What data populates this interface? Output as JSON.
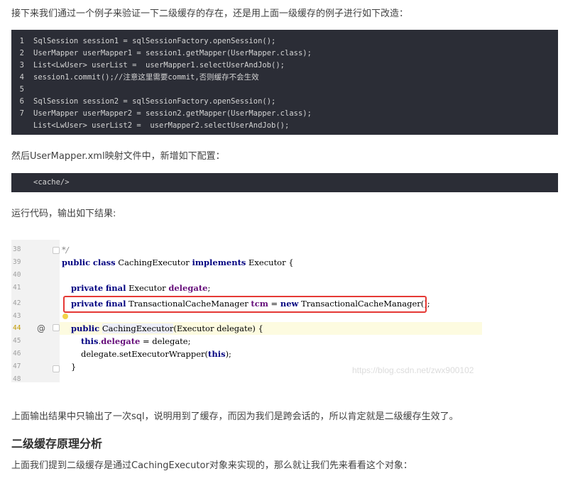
{
  "intro_text": "接下来我们通过一个例子来验证一下二级缓存的存在，还是用上面一级缓存的例子进行如下改造：",
  "code_block_1": {
    "lines": [
      {
        "num": "1",
        "text": "SqlSession session1 = sqlSessionFactory.openSession();"
      },
      {
        "num": "2",
        "text": "UserMapper userMapper1 = session1.getMapper(UserMapper.class);"
      },
      {
        "num": "3",
        "text": "List<LwUser> userList =  userMapper1.selectUserAndJob();"
      },
      {
        "num": "4",
        "text": "session1.commit();//注意这里需要commit,否则缓存不会生效"
      },
      {
        "num": "5",
        "text": ""
      },
      {
        "num": "6",
        "text": "SqlSession session2 = sqlSessionFactory.openSession();"
      },
      {
        "num": "7",
        "text": "UserMapper userMapper2 = session2.getMapper(UserMapper.class);"
      },
      {
        "num": "",
        "text": "List<LwUser> userList2 =  userMapper2.selectUserAndJob();"
      }
    ]
  },
  "config_text": "然后UserMapper.xml映射文件中，新增如下配置：",
  "code_block_2": {
    "text": "<cache/>"
  },
  "run_text": "运行代码，输出如下结果:",
  "ide": {
    "line_numbers": [
      "38",
      "39",
      "40",
      "41",
      "42",
      "43",
      "44",
      "45",
      "46",
      "47",
      "48"
    ],
    "at_symbol": "@",
    "watermark": "https://blog.csdn.net/zwx900102",
    "l38": "*/",
    "l39": {
      "kw1": "public",
      "kw2": "class",
      "name": " CachingExecutor ",
      "kw3": "implements",
      "rest": " Executor {"
    },
    "l41": {
      "kw1": "private",
      "kw2": "final",
      "type": " Executor ",
      "field": "delegate",
      "rest": ";"
    },
    "l42": {
      "kw1": "private",
      "kw2": "final",
      "type": " TransactionalCacheManager ",
      "field": "tcm",
      "eq": " = ",
      "kw3": "new",
      "rest": " TransactionalCacheManager();"
    },
    "l44": {
      "kw1": "public",
      "method": "CachingExecutor",
      "rest": "(Executor delegate) {"
    },
    "l45": {
      "kw1": "this",
      "dot": ".",
      "field": "delegate",
      "rest": " = delegate;"
    },
    "l46": {
      "pre": "delegate.setExecutorWrapper(",
      "kw1": "this",
      "rest": ");"
    },
    "l47": "}"
  },
  "result_text": "上面输出结果中只输出了一次sql，说明用到了缓存，而因为我们是跨会话的，所以肯定就是二级缓存生效了。",
  "section_heading": "二级缓存原理分析",
  "closing_text": "上面我们提到二级缓存是通过CachingExecutor对象来实现的，那么就让我们先来看看这个对象："
}
